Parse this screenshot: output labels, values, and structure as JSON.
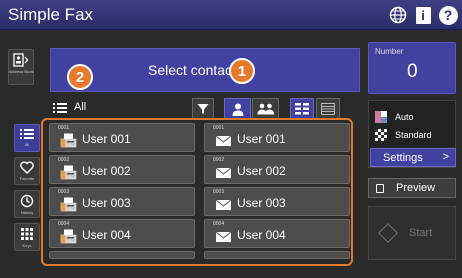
{
  "app": {
    "title": "Simple Fax"
  },
  "header_icons": {
    "globe": "globe-icon",
    "info": "info-icon",
    "help": "help-icon",
    "help_glyph": "?",
    "info_glyph": "i"
  },
  "left_nav": [
    {
      "label": "Address Book",
      "icon": "address-book-icon"
    },
    {
      "label": "All",
      "icon": "list-icon",
      "active": true
    },
    {
      "label": "Favorite",
      "icon": "heart-icon"
    },
    {
      "label": "History",
      "icon": "history-icon"
    },
    {
      "label": "Keys",
      "icon": "keypad-icon"
    }
  ],
  "select_banner": {
    "text": "Select contac"
  },
  "list_header": {
    "label": "All"
  },
  "callouts": {
    "one": "1",
    "two": "2"
  },
  "contacts": [
    {
      "num": "0001",
      "name": "User 001",
      "type": "fax"
    },
    {
      "num": "0001",
      "name": "User 001",
      "type": "email"
    },
    {
      "num": "0002",
      "name": "User 002",
      "type": "fax"
    },
    {
      "num": "0002",
      "name": "User 002",
      "type": "email"
    },
    {
      "num": "0003",
      "name": "User 003",
      "type": "fax"
    },
    {
      "num": "0003",
      "name": "User 003",
      "type": "email"
    },
    {
      "num": "0004",
      "name": "User 004",
      "type": "fax"
    },
    {
      "num": "0004",
      "name": "User 004",
      "type": "email"
    }
  ],
  "number_panel": {
    "label": "Number",
    "value": "0"
  },
  "settings_panel": {
    "mode": "Auto",
    "quality": "Standard",
    "button": "Settings",
    "chevron": ">"
  },
  "preview_button": "Preview",
  "start_button": "Start",
  "colors": {
    "accent": "#4141a0",
    "callout": "#e8792a",
    "title_bar": "#33337a"
  }
}
